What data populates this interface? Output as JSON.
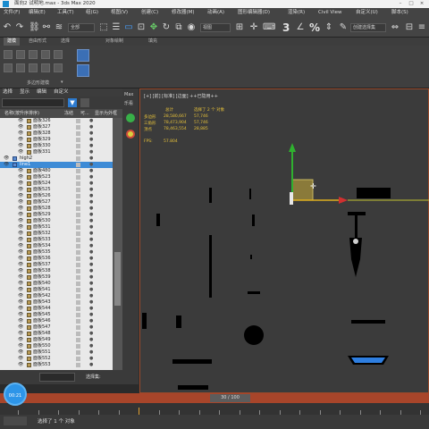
{
  "window": {
    "title": "面向2 试明地.max - 3ds Max 2020",
    "minimize": "–",
    "maximize": "□",
    "close": "×"
  },
  "menubar": {
    "items": [
      "文件(F)",
      "编辑(E)",
      "工具(T)",
      "组(G)",
      "视图(V)",
      "创建(C)",
      "修改器(M)",
      "动画(A)",
      "图形编辑器(D)",
      "渲染(R)",
      "Civil View",
      "自定义(U)",
      "脚本(S)"
    ]
  },
  "toolbar": {
    "selection_set": "全部",
    "view_dropdown": "视图",
    "named_set": "创建选择集",
    "snap_numbers": [
      "3",
      "2",
      "%"
    ]
  },
  "ribbon": {
    "tabs": [
      "建模",
      "自由形式",
      "选择",
      "对象绘制",
      "填充"
    ],
    "panel_label": "多边形建模"
  },
  "explorer": {
    "menu": [
      "选择",
      "显示",
      "编辑",
      "自定义"
    ],
    "columns": {
      "name": "名称(按升序排序)",
      "frozen": "冻结",
      "renderable": "可...",
      "display": "显示为外框"
    },
    "rows": [
      {
        "name": "面板326"
      },
      {
        "name": "面板327"
      },
      {
        "name": "面板328"
      },
      {
        "name": "面板329"
      },
      {
        "name": "面板330"
      },
      {
        "name": "面板331"
      },
      {
        "name": "high2"
      },
      {
        "name": "line1"
      },
      {
        "name": "面板480"
      },
      {
        "name": "面板523"
      },
      {
        "name": "面板524"
      },
      {
        "name": "面板525"
      },
      {
        "name": "面板526"
      },
      {
        "name": "面板527"
      },
      {
        "name": "面板528"
      },
      {
        "name": "面板529"
      },
      {
        "name": "面板530"
      },
      {
        "name": "面板531"
      },
      {
        "name": "面板532"
      },
      {
        "name": "面板533"
      },
      {
        "name": "面板534"
      },
      {
        "name": "面板535"
      },
      {
        "name": "面板536"
      },
      {
        "name": "面板537"
      },
      {
        "name": "面板538"
      },
      {
        "name": "面板539"
      },
      {
        "name": "面板540"
      },
      {
        "name": "面板541"
      },
      {
        "name": "面板542"
      },
      {
        "name": "面板543"
      },
      {
        "name": "面板544"
      },
      {
        "name": "面板545"
      },
      {
        "name": "面板546"
      },
      {
        "name": "面板547"
      },
      {
        "name": "面板548"
      },
      {
        "name": "面板549"
      },
      {
        "name": "面板550"
      },
      {
        "name": "面板551"
      },
      {
        "name": "面板552"
      },
      {
        "name": "面板553"
      }
    ],
    "bottom_label": "选择集:"
  },
  "midcol": {
    "label_top": "Max",
    "label2": "乐看"
  },
  "viewport": {
    "label": "[+] [前] [标准] [边面] ++已隐用++",
    "stats": {
      "headers": [
        "总计",
        "选择了 2 个 对象"
      ],
      "rows": [
        {
          "label": "多边形",
          "total": "28,580,667",
          "sel": "57,746"
        },
        {
          "label": "三角形",
          "total": "78,473,904",
          "sel": "57,746"
        },
        {
          "label": "顶点",
          "total": "78,463,554",
          "sel": "28,885"
        }
      ],
      "fps_label": "FPS:",
      "fps": "57.804"
    }
  },
  "timeline": {
    "slider": "30 / 100"
  },
  "status": {
    "timer": "00:21",
    "message": "选择了 1 个 对象"
  }
}
